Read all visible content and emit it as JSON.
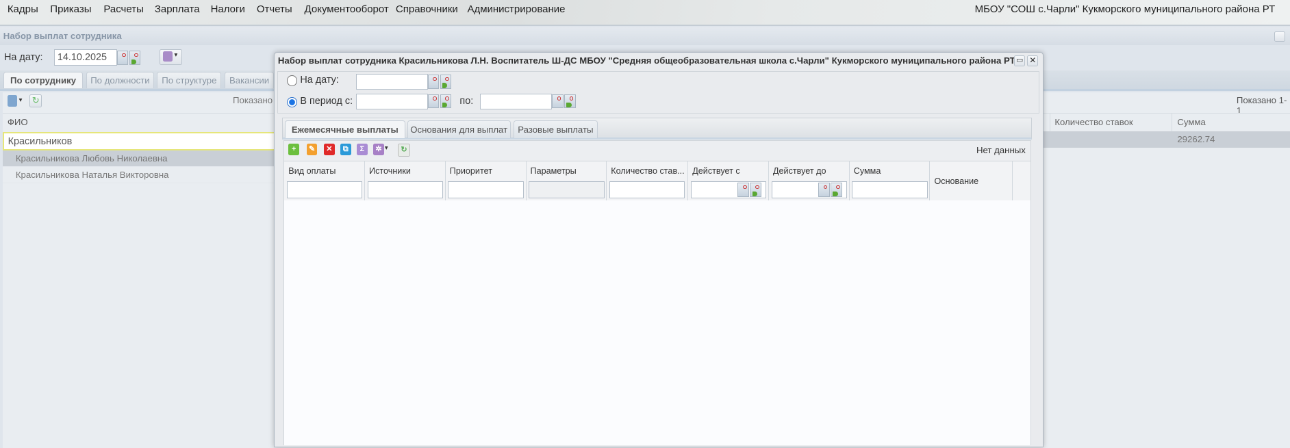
{
  "menu": {
    "items": [
      "Кадры",
      "Приказы",
      "Расчеты",
      "Зарплата",
      "Налоги",
      "Отчеты",
      "Документооборот",
      "Справочники",
      "Администрирование"
    ],
    "organization": "МБОУ \"СОШ с.Чарли\" Кукморского муниципального района РТ"
  },
  "panel": {
    "title": "Набор выплат сотрудника",
    "date_label": "На дату:",
    "date_value": "14.10.2025",
    "tabs": [
      "По сотруднику",
      "По должности",
      "По структуре",
      "Вакансии"
    ],
    "active_tab": "По сотруднику",
    "shown_left": "Показано",
    "shown_right": "Показано 1-1",
    "grid": {
      "col_fio": "ФИО",
      "filter_value": "Красильников",
      "rows": [
        "Красильникова Любовь Николаевна",
        "Красильникова Наталья Викторовна"
      ],
      "right_columns": [
        "Количество ставок",
        "Сумма"
      ],
      "right_row": {
        "count": "",
        "sum": "29262.74"
      }
    }
  },
  "dialog": {
    "title": "Набор выплат сотрудника Красильникова Л.Н. Воспитатель Ш-ДС МБОУ \"Средняя общеобразовательная школа с.Чарли\" Кукморского муниципального района РТ",
    "radio_date": "На дату:",
    "radio_period": "В период с:",
    "to_label": "по:",
    "selected_radio": "period",
    "date_value": "",
    "period_from": "",
    "period_to": "",
    "tabs": [
      "Ежемесячные выплаты",
      "Основания для выплат",
      "Разовые выплаты"
    ],
    "active_tab": "Ежемесячные выплаты",
    "no_data": "Нет данных",
    "columns": [
      "Вид оплаты",
      "Источники",
      "Приоритет",
      "Параметры",
      "Количество став...",
      "Действует с",
      "Действует до",
      "Сумма",
      "Основание"
    ],
    "toolbar_icons": [
      "add-icon",
      "edit-icon",
      "delete-icon",
      "copy-icon",
      "sum-icon",
      "settings-icon",
      "refresh-icon"
    ]
  }
}
